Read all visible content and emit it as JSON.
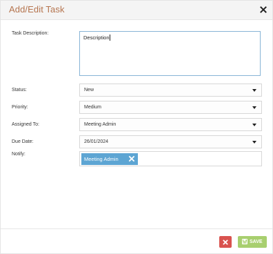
{
  "dialog": {
    "title": "Add/Edit Task",
    "close_icon": "close-icon"
  },
  "form": {
    "task_description": {
      "label": "Task Description:",
      "value": "Description"
    },
    "status": {
      "label": "Status:",
      "value": "New"
    },
    "priority": {
      "label": "Priority:",
      "value": "Medium"
    },
    "assigned_to": {
      "label": "Assigned To:",
      "value": "Meeting Admin"
    },
    "due_date": {
      "label": "Due Date:",
      "value": "26/01/2024"
    },
    "notify": {
      "label": "Notify:",
      "tags": [
        "Meeting Admin"
      ]
    }
  },
  "footer": {
    "cancel_icon": "cancel-x-icon",
    "save_label": "SAVE",
    "save_icon": "floppy-disk-icon"
  },
  "colors": {
    "title": "#b5744e",
    "tag_bg": "#5da5d3",
    "cancel_bg": "#d9534f",
    "save_bg": "#a8cf6f",
    "textarea_border": "#86b3d6"
  }
}
